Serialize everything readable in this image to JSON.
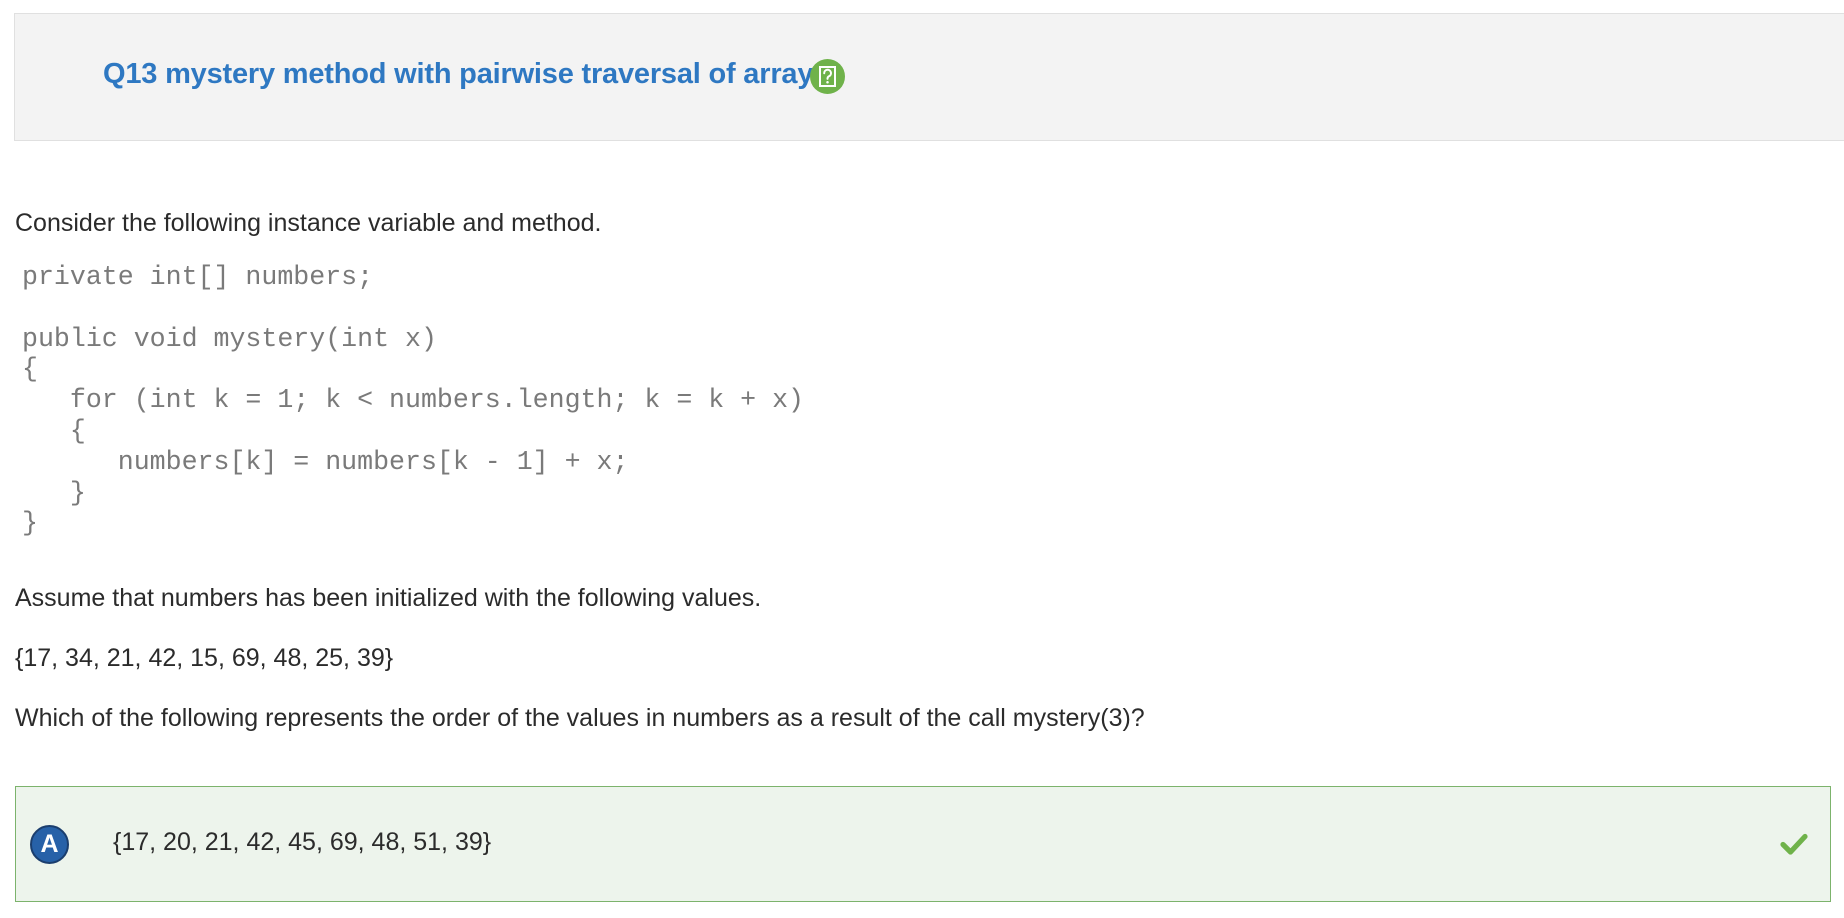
{
  "header": {
    "title": "Q13 mystery method with pairwise traversal of array",
    "help_icon": "help-question-icon"
  },
  "question": {
    "intro": "Consider the following instance variable and method.",
    "code_lines": [
      "private int[] numbers;",
      "",
      "public void mystery(int x)",
      "{",
      "   for (int k = 1; k < numbers.length; k = k + x)",
      "   {",
      "      numbers[k] = numbers[k - 1] + x;",
      "   }",
      "}"
    ],
    "assumption": "Assume that numbers has been initialized with the following values.",
    "values": "{17, 34, 21, 42, 15, 69, 48, 25, 39}",
    "prompt": "Which of the following represents the order of the values in numbers as a result of the call mystery(3)?"
  },
  "answer": {
    "letter": "A",
    "text": "{17, 20, 21, 42, 45, 69, 48, 51, 39}",
    "status_icon": "checkmark-icon",
    "correct_color": "#6fb24a"
  },
  "colors": {
    "title": "#2e78c2",
    "answer_background": "#edf4ec",
    "answer_border": "#7cb36c",
    "letter_badge": "#2761a8"
  }
}
